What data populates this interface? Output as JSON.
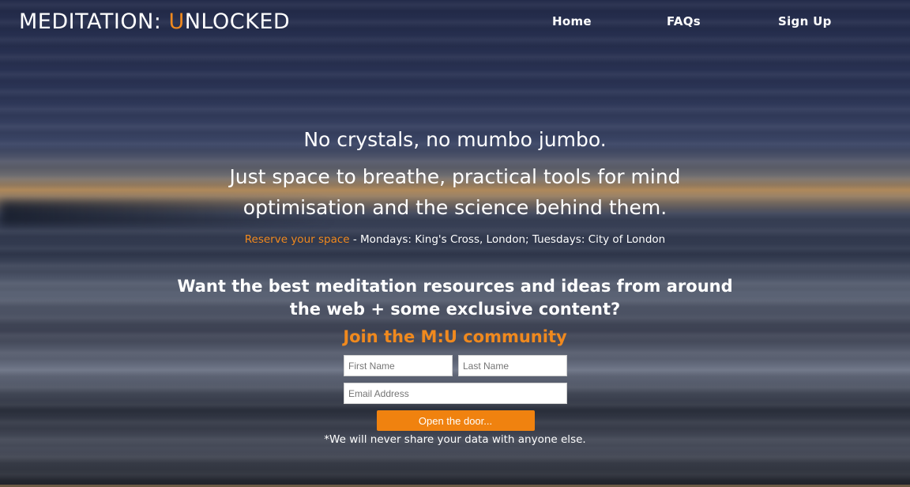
{
  "brand": {
    "logo_part1": "MEDITATION: ",
    "logo_accent": "U",
    "logo_part2": "NLOCKED"
  },
  "nav": {
    "home": "Home",
    "faqs": "FAQs",
    "signup": "Sign Up"
  },
  "hero": {
    "line1": "No crystals, no mumbo jumbo.",
    "line2": "Just space to breathe, practical tools for mind optimisation and the science behind them.",
    "reserve_link": "Reserve your space",
    "reserve_details": " - Mondays: King's Cross, London; Tuesdays: City of London"
  },
  "community": {
    "heading": "Want the best meditation resources and ideas from around the web + some exclusive content?",
    "join": "Join the M:U community"
  },
  "form": {
    "first_name_placeholder": "First Name",
    "last_name_placeholder": "Last Name",
    "email_placeholder": "Email Address",
    "submit_label": "Open the door...",
    "first_name_value": "",
    "last_name_value": "",
    "email_value": ""
  },
  "disclaimer": "*We will never share your data with anyone else.",
  "colors": {
    "accent": "#f0891e",
    "button": "#f0820f",
    "text": "#ffffff"
  }
}
